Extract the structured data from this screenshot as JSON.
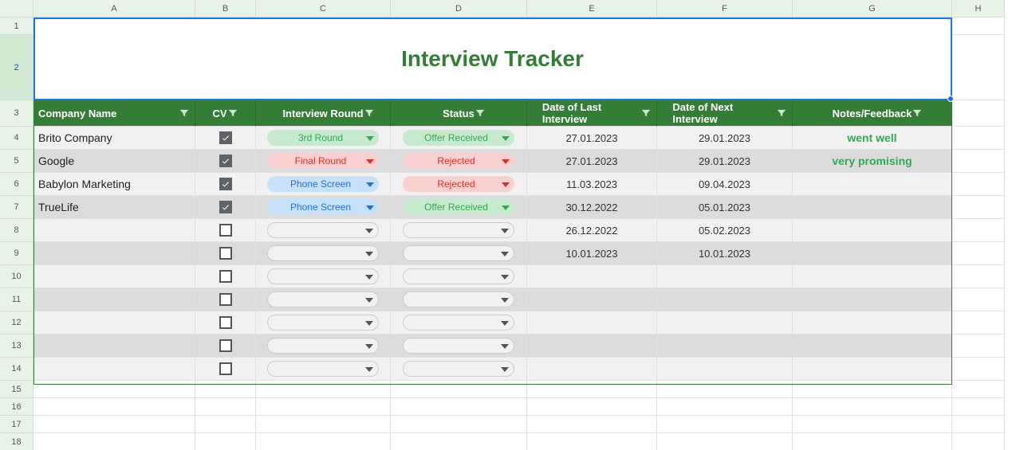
{
  "columns": [
    "A",
    "B",
    "C",
    "D",
    "E",
    "F",
    "G",
    "H"
  ],
  "row_numbers": [
    1,
    2,
    3,
    4,
    5,
    6,
    7,
    8,
    9,
    10,
    11,
    12,
    13,
    14,
    15,
    16,
    17,
    18
  ],
  "title": "Interview Tracker",
  "headers": {
    "company": "Company Name",
    "cv": "CV",
    "round": "Interview Round",
    "status": "Status",
    "last": "Date of Last Interview",
    "next": "Date of Next Interview",
    "notes": "Notes/Feedback"
  },
  "rows": [
    {
      "company": "Brito Company",
      "cv": true,
      "round": "3rd Round",
      "round_color": "green",
      "status": "Offer Received",
      "status_color": "green",
      "last": "27.01.2023",
      "next": "29.01.2023",
      "notes": "went well",
      "shade": "light"
    },
    {
      "company": "Google",
      "cv": true,
      "round": "Final Round",
      "round_color": "red",
      "status": "Rejected",
      "status_color": "red",
      "last": "27.01.2023",
      "next": "29.01.2023",
      "notes": "very promising",
      "shade": "dark"
    },
    {
      "company": "Babylon Marketing",
      "cv": true,
      "round": "Phone Screen",
      "round_color": "blue",
      "status": "Rejected",
      "status_color": "red",
      "last": "11.03.2023",
      "next": "09.04.2023",
      "notes": "",
      "shade": "light"
    },
    {
      "company": "TrueLife",
      "cv": true,
      "round": "Phone Screen",
      "round_color": "blue",
      "status": "Offer Received",
      "status_color": "green",
      "last": "30.12.2022",
      "next": "05.01.2023",
      "notes": "",
      "shade": "dark"
    },
    {
      "company": "",
      "cv": false,
      "round": "",
      "round_color": "",
      "status": "",
      "status_color": "",
      "last": "26.12.2022",
      "next": "05.02.2023",
      "notes": "",
      "shade": "light"
    },
    {
      "company": "",
      "cv": false,
      "round": "",
      "round_color": "",
      "status": "",
      "status_color": "",
      "last": "10.01.2023",
      "next": "10.01.2023",
      "notes": "",
      "shade": "dark"
    },
    {
      "company": "",
      "cv": false,
      "round": "",
      "round_color": "",
      "status": "",
      "status_color": "",
      "last": "",
      "next": "",
      "notes": "",
      "shade": "light"
    },
    {
      "company": "",
      "cv": false,
      "round": "",
      "round_color": "",
      "status": "",
      "status_color": "",
      "last": "",
      "next": "",
      "notes": "",
      "shade": "dark"
    },
    {
      "company": "",
      "cv": false,
      "round": "",
      "round_color": "",
      "status": "",
      "status_color": "",
      "last": "",
      "next": "",
      "notes": "",
      "shade": "light"
    },
    {
      "company": "",
      "cv": false,
      "round": "",
      "round_color": "",
      "status": "",
      "status_color": "",
      "last": "",
      "next": "",
      "notes": "",
      "shade": "dark"
    },
    {
      "company": "",
      "cv": false,
      "round": "",
      "round_color": "",
      "status": "",
      "status_color": "",
      "last": "",
      "next": "",
      "notes": "",
      "shade": "light"
    }
  ],
  "colors": {
    "header_green": "#347d36",
    "pill_green_bg": "#c7e9ce",
    "pill_green_fg": "#34a853",
    "pill_red_bg": "#f8d0d0",
    "pill_red_fg": "#d93025",
    "pill_blue_bg": "#c9e0fa",
    "pill_blue_fg": "#1a73e8",
    "selection": "#1a73e8"
  },
  "chart_data": {
    "type": "table",
    "title": "Interview Tracker",
    "columns": [
      "Company Name",
      "CV",
      "Interview Round",
      "Status",
      "Date of Last Interview",
      "Date of Next Interview",
      "Notes/Feedback"
    ],
    "rows": [
      [
        "Brito Company",
        true,
        "3rd Round",
        "Offer Received",
        "27.01.2023",
        "29.01.2023",
        "went well"
      ],
      [
        "Google",
        true,
        "Final Round",
        "Rejected",
        "27.01.2023",
        "29.01.2023",
        "very promising"
      ],
      [
        "Babylon Marketing",
        true,
        "Phone Screen",
        "Rejected",
        "11.03.2023",
        "09.04.2023",
        ""
      ],
      [
        "TrueLife",
        true,
        "Phone Screen",
        "Offer Received",
        "30.12.2022",
        "05.01.2023",
        ""
      ],
      [
        "",
        false,
        "",
        "",
        "26.12.2022",
        "05.02.2023",
        ""
      ],
      [
        "",
        false,
        "",
        "",
        "10.01.2023",
        "10.01.2023",
        ""
      ]
    ]
  }
}
